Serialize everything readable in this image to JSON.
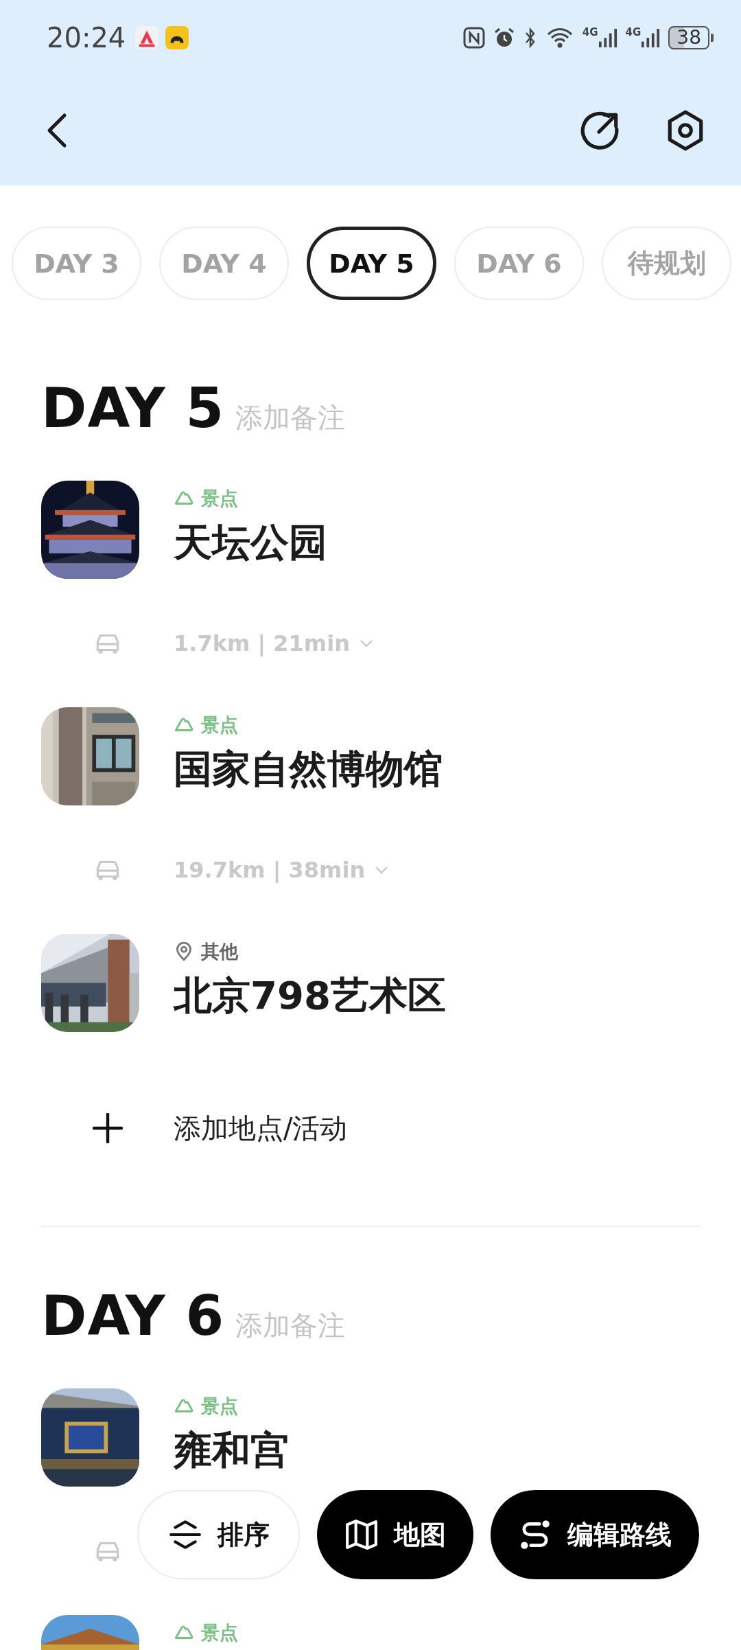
{
  "status_bar": {
    "time": "20:24",
    "network_labels": [
      "4G",
      "4G"
    ],
    "battery": "38"
  },
  "tabs": [
    {
      "label": "DAY 3",
      "selected": false
    },
    {
      "label": "DAY 4",
      "selected": false
    },
    {
      "label": "DAY 5",
      "selected": true
    },
    {
      "label": "DAY 6",
      "selected": false
    },
    {
      "label": "待规划",
      "selected": false
    }
  ],
  "days": [
    {
      "title": "DAY 5",
      "note_placeholder": "添加备注",
      "entries": [
        {
          "kind": "place",
          "category": {
            "kind": "scenic",
            "label": "景点"
          },
          "name": "天坛公园"
        },
        {
          "kind": "travel",
          "text": "1.7km | 21min"
        },
        {
          "kind": "place",
          "category": {
            "kind": "scenic",
            "label": "景点"
          },
          "name": "国家自然博物馆"
        },
        {
          "kind": "travel",
          "text": "19.7km | 38min"
        },
        {
          "kind": "place",
          "category": {
            "kind": "other",
            "label": "其他"
          },
          "name": "北京798艺术区"
        }
      ],
      "add_label": "添加地点/活动"
    },
    {
      "title": "DAY 6",
      "note_placeholder": "添加备注",
      "entries": [
        {
          "kind": "place",
          "category": {
            "kind": "scenic",
            "label": "景点"
          },
          "name": "雍和宫"
        },
        {
          "kind": "travel_covered"
        },
        {
          "kind": "place",
          "category": {
            "kind": "scenic",
            "label": "景点"
          }
        }
      ]
    }
  ],
  "actions": [
    {
      "label": "排序",
      "kind": "light"
    },
    {
      "label": "地图",
      "kind": "dark"
    },
    {
      "label": "编辑路线",
      "kind": "dark"
    }
  ]
}
